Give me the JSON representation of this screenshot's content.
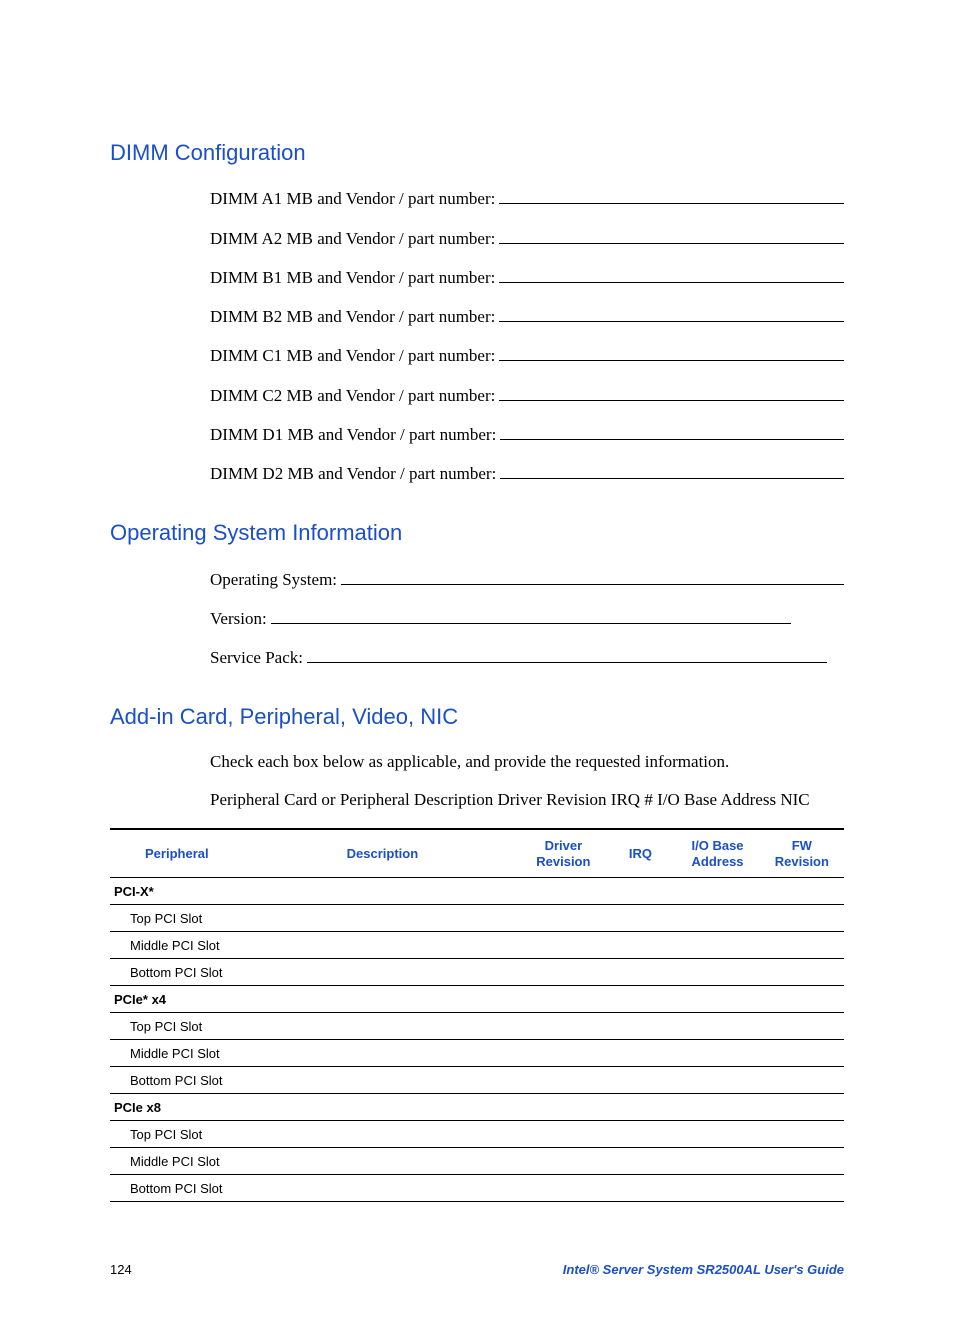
{
  "sections": {
    "dimm": {
      "heading": "DIMM Configuration",
      "lines": [
        "DIMM A1 MB and Vendor / part number:",
        "DIMM A2 MB and Vendor / part number:",
        "DIMM B1 MB and Vendor / part number:",
        "DIMM B2 MB and Vendor / part number:",
        "DIMM C1 MB and Vendor / part number:",
        "DIMM C2 MB and Vendor / part number:",
        "DIMM D1 MB and Vendor / part number:",
        "DIMM D2 MB and Vendor / part number:"
      ]
    },
    "os": {
      "heading": "Operating System Information",
      "lines": [
        "Operating System:",
        "Version:",
        "Service Pack:"
      ]
    },
    "addin": {
      "heading": "Add-in Card, Peripheral, Video, NIC",
      "intro1": "Check each box below as applicable, and provide the requested information.",
      "intro2": "Peripheral Card or Peripheral Description Driver Revision IRQ # I/O Base Address NIC",
      "table": {
        "headers": [
          "Peripheral",
          "Description",
          "Driver Revision",
          "IRQ",
          "I/O Base Address",
          "FW Revision"
        ],
        "rows": [
          {
            "label": "PCI-X*",
            "type": "group"
          },
          {
            "label": "Top PCI Slot",
            "type": "sub"
          },
          {
            "label": "Middle PCI Slot",
            "type": "sub"
          },
          {
            "label": "Bottom PCI Slot",
            "type": "sub"
          },
          {
            "label": "PCIe* x4",
            "type": "group"
          },
          {
            "label": "Top PCI Slot",
            "type": "sub"
          },
          {
            "label": "Middle PCI Slot",
            "type": "sub"
          },
          {
            "label": "Bottom PCI Slot",
            "type": "sub"
          },
          {
            "label": "PCIe x8",
            "type": "group"
          },
          {
            "label": "Top PCI Slot",
            "type": "sub"
          },
          {
            "label": "Middle PCI Slot",
            "type": "sub"
          },
          {
            "label": "Bottom PCI Slot",
            "type": "sub"
          }
        ]
      }
    }
  },
  "footer": {
    "page": "124",
    "title": "Intel® Server System SR2500AL User's Guide"
  }
}
